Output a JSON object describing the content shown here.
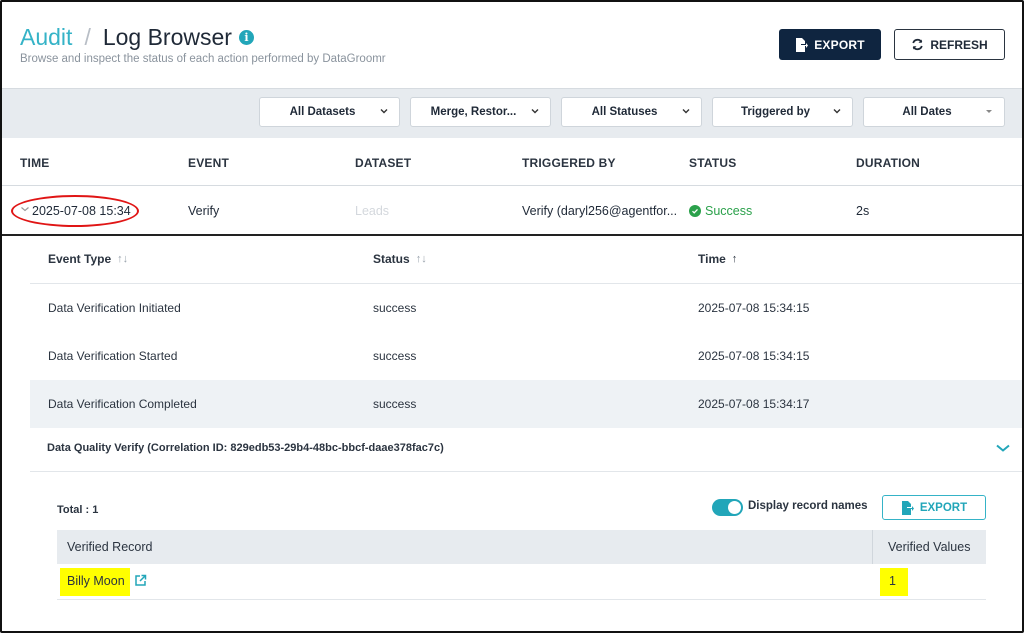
{
  "header": {
    "breadcrumb_root": "Audit",
    "breadcrumb_sep": "/",
    "page_title": "Log Browser",
    "info_glyph": "i",
    "subtitle": "Browse and inspect the status of each action performed by DataGroomr",
    "export_label": "EXPORT",
    "refresh_label": "REFRESH"
  },
  "filters": {
    "datasets": "All Datasets",
    "events": "Merge, Restor...",
    "statuses": "All Statuses",
    "triggered_by": "Triggered by",
    "dates": "All Dates"
  },
  "table": {
    "columns": [
      "TIME",
      "EVENT",
      "DATASET",
      "TRIGGERED BY",
      "STATUS",
      "DURATION"
    ],
    "row": {
      "time": "2025-07-08 15:34",
      "event": "Verify",
      "dataset": "Leads",
      "triggered_by": "Verify (daryl256@agentfor...",
      "status": "Success",
      "duration": "2s"
    }
  },
  "details": {
    "columns": {
      "event_type": "Event Type",
      "status": "Status",
      "time": "Time",
      "event_type_sort_glyph": "↑↓",
      "status_sort_glyph": "↑↓",
      "time_sort_glyph": "↑"
    },
    "rows": [
      {
        "event_type": "Data Verification Initiated",
        "status": "success",
        "time": "2025-07-08 15:34:15"
      },
      {
        "event_type": "Data Verification Started",
        "status": "success",
        "time": "2025-07-08 15:34:15"
      },
      {
        "event_type": "Data Verification Completed",
        "status": "success",
        "time": "2025-07-08 15:34:17"
      }
    ],
    "correlation": "Data Quality Verify (Correlation ID: 829edb53-29b4-48bc-bbcf-daae378fac7c)"
  },
  "verify": {
    "total": "Total : 1",
    "toggle_label": "Display record names",
    "toggle_on": true,
    "export_label": "EXPORT",
    "columns": {
      "record": "Verified Record",
      "values": "Verified Values"
    },
    "rows": [
      {
        "record": "Billy Moon",
        "values": "1"
      }
    ]
  },
  "colors": {
    "accent": "#22a6b9",
    "navy": "#0f2540",
    "success": "#2ba14b",
    "highlight": "#ffff00",
    "annotation": "#e01515"
  }
}
